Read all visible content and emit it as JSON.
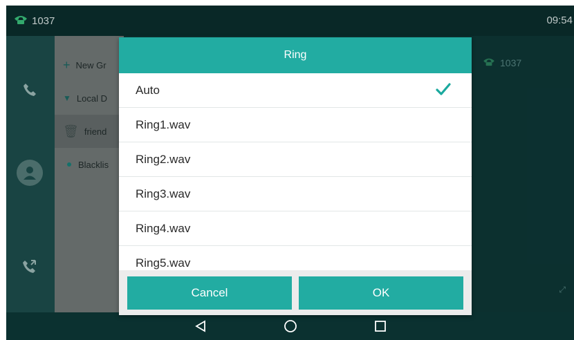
{
  "statusbar": {
    "account": "1037",
    "time": "09:54"
  },
  "panel": {
    "items": [
      {
        "label": "New Gr",
        "icon": "plus-icon"
      },
      {
        "label": "Local D",
        "icon": "triangle-down-icon"
      },
      {
        "label": "friend",
        "icon": "trash-icon"
      },
      {
        "label": "Blacklis",
        "icon": "dot-icon"
      }
    ]
  },
  "right": {
    "account": "1037"
  },
  "dialog": {
    "title": "Ring",
    "options": [
      {
        "label": "Auto",
        "selected": true
      },
      {
        "label": "Ring1.wav",
        "selected": false
      },
      {
        "label": "Ring2.wav",
        "selected": false
      },
      {
        "label": "Ring3.wav",
        "selected": false
      },
      {
        "label": "Ring4.wav",
        "selected": false
      },
      {
        "label": "Ring5.wav",
        "selected": false
      }
    ],
    "cancel_label": "Cancel",
    "ok_label": "OK"
  },
  "colors": {
    "accent": "#22aca2",
    "background": "#0f3b3a",
    "check": "#1aa99e"
  }
}
